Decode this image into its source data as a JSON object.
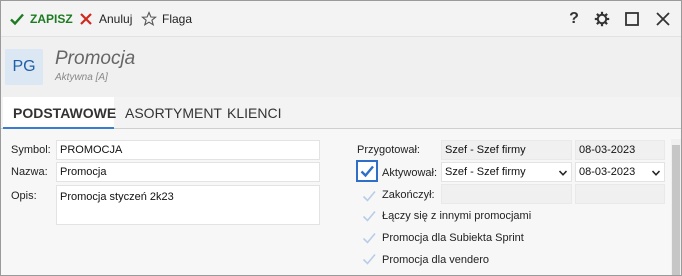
{
  "toolbar": {
    "save_label": "ZAPISZ",
    "cancel_label": "Anuluj",
    "flag_label": "Flaga"
  },
  "window_controls": {
    "help": "?"
  },
  "header": {
    "avatar_initials": "PG",
    "title": "Promocja",
    "subtitle": "Aktywna [A]"
  },
  "tabs": [
    {
      "label": "PODSTAWOWE",
      "active": true
    },
    {
      "label": "ASORTYMENT",
      "active": false
    },
    {
      "label": "KLIENCI",
      "active": false
    }
  ],
  "form": {
    "symbol_label": "Symbol:",
    "symbol_value": "PROMOCJA",
    "name_label": "Nazwa:",
    "name_value": "Promocja",
    "desc_label": "Opis:",
    "desc_value": "Promocja styczeń 2k23"
  },
  "right": {
    "prepared_label": "Przygotował:",
    "prepared_value": "Szef - Szef firmy",
    "prepared_date": "08-03-2023",
    "activated_label": "Aktywował:",
    "activated_value": "Szef - Szef firmy",
    "activated_date": "08-03-2023",
    "activated_checked": true,
    "finished_label": "Zakończył:",
    "finished_checked": false,
    "combine_label": "Łączy się z innymi promocjami",
    "combine_checked": false,
    "sprint_label": "Promocja dla Subiekta Sprint",
    "sprint_checked": false,
    "vendero_label": "Promocja dla vendero",
    "vendero_checked": false
  },
  "colors": {
    "accent": "#2f6fc7",
    "save_green": "#1e7b23",
    "cancel_red": "#d0281e"
  }
}
